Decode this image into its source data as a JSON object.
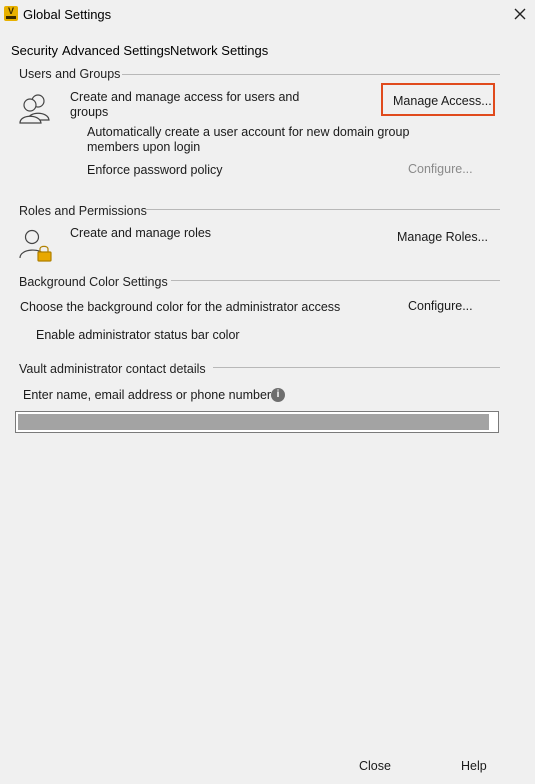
{
  "window": {
    "title": "Global Settings",
    "app_icon_letter": "V"
  },
  "tabs": [
    "Security",
    "Advanced Settings",
    "Network Settings"
  ],
  "users_groups": {
    "label": "Users and Groups",
    "description_line1": "Create and manage access for users and",
    "description_line2": "groups",
    "manage_button": "Manage Access...",
    "auto_create_line1": "Automatically create a user account for new domain group",
    "auto_create_line2": "members upon login",
    "enforce_policy": "Enforce password policy",
    "configure_button": "Configure..."
  },
  "roles": {
    "label": "Roles and Permissions",
    "description": "Create and manage roles",
    "manage_button": "Manage Roles..."
  },
  "background": {
    "label": "Background Color Settings",
    "description": "Choose the background color for the administrator access",
    "configure_button": "Configure...",
    "status_bar": "Enable administrator status bar color"
  },
  "contact": {
    "label": "Vault administrator contact details",
    "prompt": "Enter name, email address or phone number",
    "info_glyph": "i"
  },
  "footer": {
    "close": "Close",
    "help": "Help"
  },
  "colors": {
    "highlight": "#e04a1c",
    "app_icon": "#e8b100",
    "lock": "#e8a800"
  }
}
